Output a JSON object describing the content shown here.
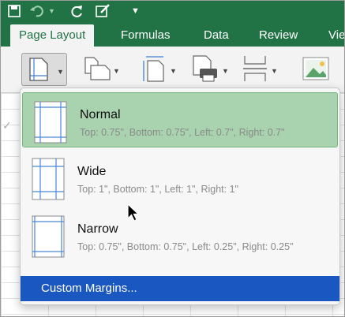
{
  "ribbon_tabs": [
    {
      "label": "Page Layout",
      "active": true
    },
    {
      "label": "Formulas",
      "active": false
    },
    {
      "label": "Data",
      "active": false
    },
    {
      "label": "Review",
      "active": false
    },
    {
      "label": "Vie",
      "active": false
    }
  ],
  "qat_icons": [
    "save-icon",
    "undo-icon",
    "redo-icon",
    "edit-icon",
    "customize-icon"
  ],
  "ribbon_buttons": [
    "margins-icon",
    "orientation-icon",
    "size-icon",
    "print-area-icon",
    "breaks-icon",
    "background-icon"
  ],
  "menu": {
    "items": [
      {
        "title": "Normal",
        "desc": "Top: 0.75\", Bottom: 0.75\", Left: 0.7\", Right: 0.7\"",
        "selected": true
      },
      {
        "title": "Wide",
        "desc": "Top: 1\", Bottom: 1\", Left: 1\", Right: 1\"",
        "selected": false
      },
      {
        "title": "Narrow",
        "desc": "Top: 0.75\", Bottom: 0.75\", Left: 0.25\", Right: 0.25\"",
        "selected": false
      }
    ],
    "custom_label": "Custom Margins..."
  },
  "colors": {
    "excel_green": "#217346",
    "selected_item": "#a9d2af",
    "highlight_blue": "#1b57c1"
  }
}
